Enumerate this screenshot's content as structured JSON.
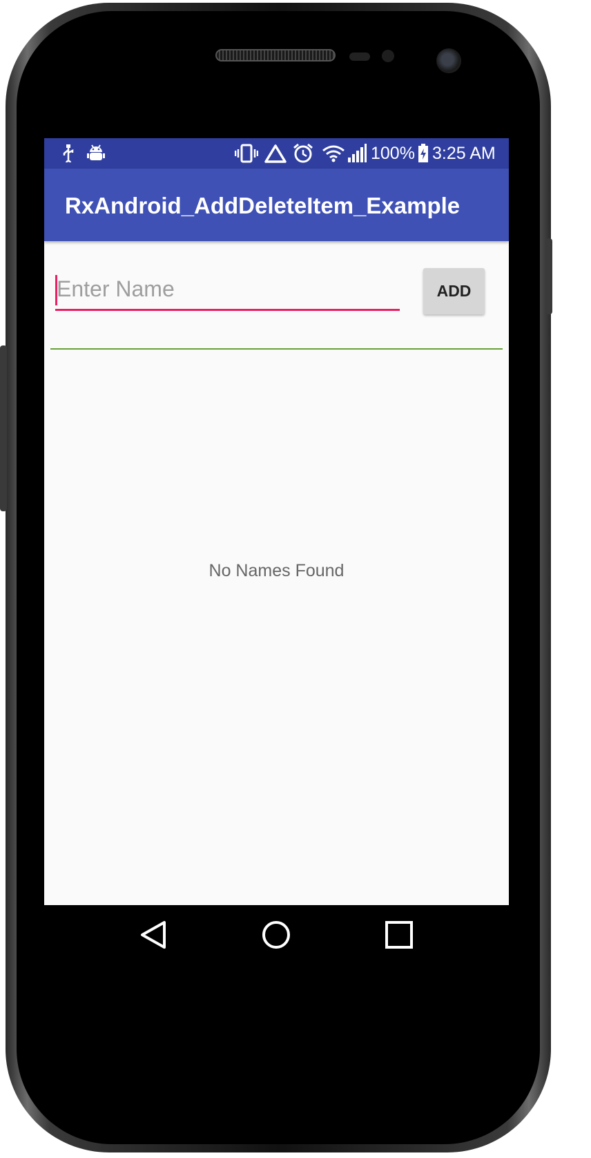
{
  "status_bar": {
    "icons": [
      "usb-icon",
      "android-debug-icon",
      "vibrate-icon",
      "warning-triangle-icon",
      "alarm-icon",
      "wifi-icon",
      "signal-icon",
      "battery-charging-icon"
    ],
    "battery_percent": "100%",
    "time": "3:25 AM"
  },
  "app_bar": {
    "title": "RxAndroid_AddDeleteItem_Example"
  },
  "form": {
    "name_input": {
      "value": "",
      "placeholder": "Enter Name"
    },
    "add_label": "ADD"
  },
  "list": {
    "empty_message": "No Names Found"
  },
  "nav_bar": {
    "icons": [
      "back-icon",
      "home-icon",
      "recents-icon"
    ]
  },
  "colors": {
    "status_bar": "#303f9f",
    "app_bar": "#3f51b5",
    "accent": "#e91e63",
    "divider": "#689f38",
    "background": "#fafafa"
  }
}
